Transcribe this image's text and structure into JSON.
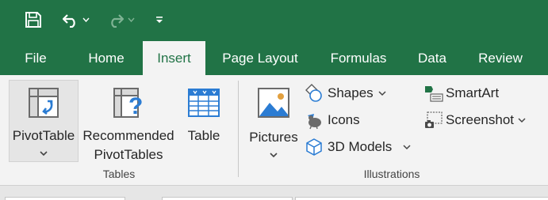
{
  "quick_access": {
    "save_icon": "save-icon",
    "undo_icon": "undo-icon",
    "redo_icon": "redo-icon",
    "customize_icon": "customize-toolbar-icon"
  },
  "tabs": [
    {
      "label": "File"
    },
    {
      "label": "Home"
    },
    {
      "label": "Insert",
      "active": true
    },
    {
      "label": "Page Layout"
    },
    {
      "label": "Formulas"
    },
    {
      "label": "Data"
    },
    {
      "label": "Review"
    }
  ],
  "ribbon": {
    "tables_group": {
      "label": "Tables",
      "pivot_table": {
        "label": "PivotTable",
        "icon": "pivot-table-icon"
      },
      "recommended": {
        "line1": "Recommended",
        "line2": "PivotTables",
        "icon": "recommended-pivot-icon"
      },
      "table": {
        "label": "Table",
        "icon": "table-icon"
      }
    },
    "illustrations_group": {
      "label": "Illustrations",
      "pictures": {
        "label": "Pictures",
        "icon": "pictures-icon"
      },
      "shapes": {
        "label": "Shapes",
        "icon": "shapes-icon"
      },
      "icons": {
        "label": "Icons",
        "icon": "icons-icon"
      },
      "models_3d": {
        "label": "3D Models",
        "icon": "3d-models-icon"
      },
      "smartart": {
        "label": "SmartArt",
        "icon": "smartart-icon"
      },
      "screenshot": {
        "label": "Screenshot",
        "icon": "screenshot-icon"
      }
    }
  },
  "colors": {
    "accent": "#217346",
    "ribbon_bg": "#f3f3f3",
    "text": "#262626"
  }
}
